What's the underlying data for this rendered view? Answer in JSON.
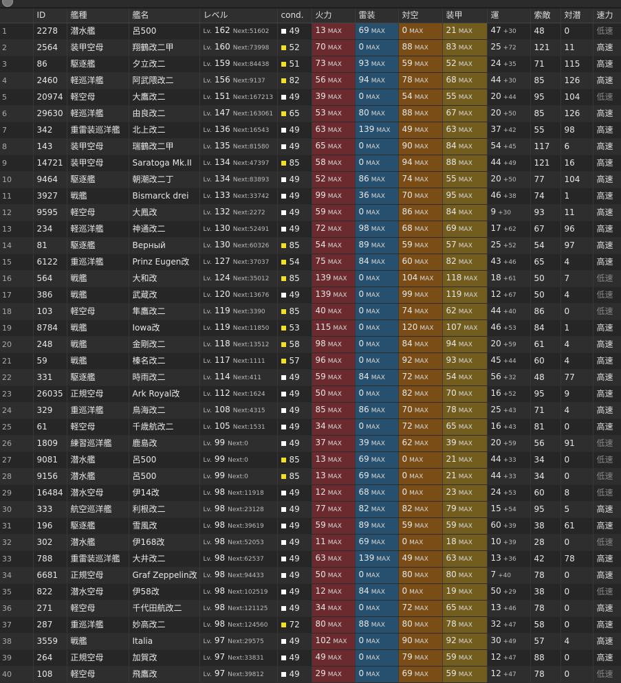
{
  "columns": [
    "ID",
    "艦種",
    "艦名",
    "レベル",
    "cond.",
    "火力",
    "雷装",
    "対空",
    "装甲",
    "運",
    "索敵",
    "対潜",
    "速力"
  ],
  "max_label": "MAX",
  "lv_prefix": "Lv.",
  "next_prefix": "Next:",
  "cond_colors": {
    "white": "#ffffff",
    "yellow": "#f2e11f"
  },
  "rows": [
    {
      "no": "1",
      "id": "2278",
      "type": "潜水艦",
      "name": "呂500",
      "lv": "162",
      "next": "51602",
      "cond": "49",
      "cc": "white",
      "fire": "13",
      "tor": "69",
      "aa": "0",
      "arm": "21",
      "luck": "47",
      "lp": "+30",
      "los": "48",
      "asw": "0",
      "spd": "低速"
    },
    {
      "no": "2",
      "id": "2564",
      "type": "装甲空母",
      "name": "翔鶴改二甲",
      "lv": "160",
      "next": "73998",
      "cond": "52",
      "cc": "yellow",
      "fire": "70",
      "tor": "0",
      "aa": "88",
      "arm": "83",
      "luck": "25",
      "lp": "+72",
      "los": "121",
      "asw": "11",
      "spd": "高速"
    },
    {
      "no": "3",
      "id": "86",
      "type": "駆逐艦",
      "name": "夕立改二",
      "lv": "159",
      "next": "84438",
      "cond": "51",
      "cc": "yellow",
      "fire": "73",
      "tor": "93",
      "aa": "59",
      "arm": "52",
      "luck": "24",
      "lp": "+35",
      "los": "71",
      "asw": "115",
      "spd": "高速"
    },
    {
      "no": "4",
      "id": "2460",
      "type": "軽巡洋艦",
      "name": "阿武隈改二",
      "lv": "156",
      "next": "9137",
      "cond": "82",
      "cc": "yellow",
      "fire": "56",
      "tor": "94",
      "aa": "78",
      "arm": "68",
      "luck": "44",
      "lp": "+30",
      "los": "85",
      "asw": "126",
      "spd": "高速"
    },
    {
      "no": "5",
      "id": "20974",
      "type": "軽空母",
      "name": "大鷹改二",
      "lv": "151",
      "next": "167213",
      "cond": "49",
      "cc": "white",
      "fire": "39",
      "tor": "0",
      "aa": "54",
      "arm": "55",
      "luck": "20",
      "lp": "+44",
      "los": "95",
      "asw": "104",
      "spd": "低速"
    },
    {
      "no": "6",
      "id": "29630",
      "type": "軽巡洋艦",
      "name": "由良改二",
      "lv": "147",
      "next": "163061",
      "cond": "65",
      "cc": "yellow",
      "fire": "53",
      "tor": "80",
      "aa": "88",
      "arm": "67",
      "luck": "20",
      "lp": "+50",
      "los": "85",
      "asw": "126",
      "spd": "高速"
    },
    {
      "no": "7",
      "id": "342",
      "type": "重雷装巡洋艦",
      "name": "北上改二",
      "lv": "136",
      "next": "16543",
      "cond": "49",
      "cc": "white",
      "fire": "63",
      "tor": "139",
      "aa": "49",
      "arm": "63",
      "luck": "37",
      "lp": "+42",
      "los": "55",
      "asw": "98",
      "spd": "高速"
    },
    {
      "no": "8",
      "id": "143",
      "type": "装甲空母",
      "name": "瑞鶴改二甲",
      "lv": "135",
      "next": "81580",
      "cond": "49",
      "cc": "white",
      "fire": "65",
      "tor": "0",
      "aa": "90",
      "arm": "84",
      "luck": "54",
      "lp": "+45",
      "los": "117",
      "asw": "6",
      "spd": "高速"
    },
    {
      "no": "9",
      "id": "14721",
      "type": "装甲空母",
      "name": "Saratoga Mk.II",
      "lv": "134",
      "next": "47397",
      "cond": "85",
      "cc": "yellow",
      "fire": "58",
      "tor": "0",
      "aa": "94",
      "arm": "88",
      "luck": "44",
      "lp": "+49",
      "los": "121",
      "asw": "16",
      "spd": "高速"
    },
    {
      "no": "10",
      "id": "9464",
      "type": "駆逐艦",
      "name": "朝潮改二丁",
      "lv": "134",
      "next": "83893",
      "cond": "49",
      "cc": "white",
      "fire": "52",
      "tor": "86",
      "aa": "74",
      "arm": "55",
      "luck": "20",
      "lp": "+50",
      "los": "77",
      "asw": "104",
      "spd": "高速"
    },
    {
      "no": "11",
      "id": "3927",
      "type": "戦艦",
      "name": "Bismarck drei",
      "lv": "133",
      "next": "33742",
      "cond": "49",
      "cc": "white",
      "fire": "99",
      "tor": "36",
      "aa": "70",
      "arm": "95",
      "luck": "46",
      "lp": "+38",
      "los": "74",
      "asw": "1",
      "spd": "高速"
    },
    {
      "no": "12",
      "id": "9595",
      "type": "軽空母",
      "name": "大鳳改",
      "lv": "132",
      "next": "2272",
      "cond": "49",
      "cc": "white",
      "fire": "59",
      "tor": "0",
      "aa": "86",
      "arm": "84",
      "luck": "9",
      "lp": "+30",
      "los": "93",
      "asw": "11",
      "spd": "高速"
    },
    {
      "no": "13",
      "id": "234",
      "type": "軽巡洋艦",
      "name": "神通改二",
      "lv": "130",
      "next": "52491",
      "cond": "49",
      "cc": "white",
      "fire": "72",
      "tor": "98",
      "aa": "68",
      "arm": "69",
      "luck": "17",
      "lp": "+62",
      "los": "67",
      "asw": "96",
      "spd": "高速"
    },
    {
      "no": "14",
      "id": "81",
      "type": "駆逐艦",
      "name": "Верный",
      "lv": "130",
      "next": "60326",
      "cond": "85",
      "cc": "yellow",
      "fire": "54",
      "tor": "89",
      "aa": "59",
      "arm": "57",
      "luck": "25",
      "lp": "+52",
      "los": "54",
      "asw": "97",
      "spd": "高速"
    },
    {
      "no": "15",
      "id": "6122",
      "type": "重巡洋艦",
      "name": "Prinz Eugen改",
      "lv": "127",
      "next": "37037",
      "cond": "54",
      "cc": "yellow",
      "fire": "75",
      "tor": "84",
      "aa": "60",
      "arm": "82",
      "luck": "43",
      "lp": "+46",
      "los": "65",
      "asw": "4",
      "spd": "高速"
    },
    {
      "no": "16",
      "id": "564",
      "type": "戦艦",
      "name": "大和改",
      "lv": "124",
      "next": "35012",
      "cond": "85",
      "cc": "yellow",
      "fire": "139",
      "tor": "0",
      "aa": "104",
      "arm": "118",
      "luck": "18",
      "lp": "+61",
      "los": "50",
      "asw": "7",
      "spd": "低速"
    },
    {
      "no": "17",
      "id": "386",
      "type": "戦艦",
      "name": "武蔵改",
      "lv": "120",
      "next": "13676",
      "cond": "49",
      "cc": "white",
      "fire": "139",
      "tor": "0",
      "aa": "99",
      "arm": "119",
      "luck": "12",
      "lp": "+67",
      "los": "50",
      "asw": "4",
      "spd": "低速"
    },
    {
      "no": "18",
      "id": "103",
      "type": "軽空母",
      "name": "隼鷹改二",
      "lv": "119",
      "next": "3390",
      "cond": "85",
      "cc": "yellow",
      "fire": "40",
      "tor": "0",
      "aa": "74",
      "arm": "62",
      "luck": "44",
      "lp": "+40",
      "los": "86",
      "asw": "0",
      "spd": "低速"
    },
    {
      "no": "19",
      "id": "8784",
      "type": "戦艦",
      "name": "Iowa改",
      "lv": "119",
      "next": "11850",
      "cond": "53",
      "cc": "yellow",
      "fire": "115",
      "tor": "0",
      "aa": "120",
      "arm": "107",
      "luck": "46",
      "lp": "+53",
      "los": "84",
      "asw": "1",
      "spd": "高速"
    },
    {
      "no": "20",
      "id": "248",
      "type": "戦艦",
      "name": "金剛改二",
      "lv": "118",
      "next": "13512",
      "cond": "58",
      "cc": "yellow",
      "fire": "98",
      "tor": "0",
      "aa": "84",
      "arm": "94",
      "luck": "20",
      "lp": "+59",
      "los": "61",
      "asw": "4",
      "spd": "高速"
    },
    {
      "no": "21",
      "id": "59",
      "type": "戦艦",
      "name": "榛名改二",
      "lv": "117",
      "next": "1111",
      "cond": "57",
      "cc": "yellow",
      "fire": "96",
      "tor": "0",
      "aa": "92",
      "arm": "93",
      "luck": "45",
      "lp": "+44",
      "los": "60",
      "asw": "4",
      "spd": "高速"
    },
    {
      "no": "22",
      "id": "331",
      "type": "駆逐艦",
      "name": "時雨改二",
      "lv": "114",
      "next": "411",
      "cond": "49",
      "cc": "white",
      "fire": "59",
      "tor": "84",
      "aa": "72",
      "arm": "54",
      "luck": "56",
      "lp": "+32",
      "los": "48",
      "asw": "77",
      "spd": "高速"
    },
    {
      "no": "23",
      "id": "26035",
      "type": "正規空母",
      "name": "Ark Royal改",
      "lv": "112",
      "next": "1624",
      "cond": "49",
      "cc": "white",
      "fire": "50",
      "tor": "0",
      "aa": "82",
      "arm": "70",
      "luck": "16",
      "lp": "+52",
      "los": "95",
      "asw": "9",
      "spd": "高速"
    },
    {
      "no": "24",
      "id": "329",
      "type": "重巡洋艦",
      "name": "鳥海改二",
      "lv": "108",
      "next": "4315",
      "cond": "49",
      "cc": "white",
      "fire": "85",
      "tor": "86",
      "aa": "70",
      "arm": "78",
      "luck": "25",
      "lp": "+43",
      "los": "71",
      "asw": "4",
      "spd": "高速"
    },
    {
      "no": "25",
      "id": "61",
      "type": "軽空母",
      "name": "千歳航改二",
      "lv": "105",
      "next": "1531",
      "cond": "49",
      "cc": "white",
      "fire": "34",
      "tor": "0",
      "aa": "72",
      "arm": "65",
      "luck": "16",
      "lp": "+43",
      "los": "81",
      "asw": "0",
      "spd": "高速"
    },
    {
      "no": "26",
      "id": "1809",
      "type": "練習巡洋艦",
      "name": "鹿島改",
      "lv": "99",
      "next": "0",
      "cond": "49",
      "cc": "white",
      "fire": "37",
      "tor": "39",
      "aa": "62",
      "arm": "39",
      "luck": "20",
      "lp": "+59",
      "los": "56",
      "asw": "91",
      "spd": "低速"
    },
    {
      "no": "27",
      "id": "9081",
      "type": "潜水艦",
      "name": "呂500",
      "lv": "99",
      "next": "0",
      "cond": "85",
      "cc": "yellow",
      "fire": "13",
      "tor": "69",
      "aa": "0",
      "arm": "21",
      "luck": "44",
      "lp": "+33",
      "los": "34",
      "asw": "0",
      "spd": "低速"
    },
    {
      "no": "28",
      "id": "9156",
      "type": "潜水艦",
      "name": "呂500",
      "lv": "99",
      "next": "0",
      "cond": "85",
      "cc": "yellow",
      "fire": "13",
      "tor": "69",
      "aa": "0",
      "arm": "21",
      "luck": "44",
      "lp": "+33",
      "los": "34",
      "asw": "0",
      "spd": "低速"
    },
    {
      "no": "29",
      "id": "16484",
      "type": "潜水空母",
      "name": "伊14改",
      "lv": "98",
      "next": "11918",
      "cond": "49",
      "cc": "white",
      "fire": "12",
      "tor": "68",
      "aa": "0",
      "arm": "23",
      "luck": "24",
      "lp": "+53",
      "los": "60",
      "asw": "8",
      "spd": "低速"
    },
    {
      "no": "30",
      "id": "333",
      "type": "航空巡洋艦",
      "name": "利根改二",
      "lv": "98",
      "next": "23128",
      "cond": "49",
      "cc": "white",
      "fire": "77",
      "tor": "82",
      "aa": "82",
      "arm": "79",
      "luck": "15",
      "lp": "+54",
      "los": "95",
      "asw": "5",
      "spd": "高速"
    },
    {
      "no": "31",
      "id": "196",
      "type": "駆逐艦",
      "name": "雪風改",
      "lv": "98",
      "next": "39619",
      "cond": "49",
      "cc": "white",
      "fire": "59",
      "tor": "89",
      "aa": "59",
      "arm": "59",
      "luck": "60",
      "lp": "+39",
      "los": "38",
      "asw": "61",
      "spd": "高速"
    },
    {
      "no": "32",
      "id": "302",
      "type": "潜水艦",
      "name": "伊168改",
      "lv": "98",
      "next": "52053",
      "cond": "49",
      "cc": "white",
      "fire": "11",
      "tor": "69",
      "aa": "0",
      "arm": "18",
      "luck": "10",
      "lp": "+39",
      "los": "28",
      "asw": "0",
      "spd": "低速"
    },
    {
      "no": "33",
      "id": "788",
      "type": "重雷装巡洋艦",
      "name": "大井改二",
      "lv": "98",
      "next": "62537",
      "cond": "49",
      "cc": "white",
      "fire": "63",
      "tor": "139",
      "aa": "49",
      "arm": "63",
      "luck": "13",
      "lp": "+36",
      "los": "42",
      "asw": "78",
      "spd": "高速"
    },
    {
      "no": "34",
      "id": "6681",
      "type": "正規空母",
      "name": "Graf Zeppelin改",
      "lv": "98",
      "next": "94433",
      "cond": "49",
      "cc": "white",
      "fire": "50",
      "tor": "0",
      "aa": "80",
      "arm": "80",
      "luck": "7",
      "lp": "+40",
      "los": "78",
      "asw": "0",
      "spd": "高速"
    },
    {
      "no": "35",
      "id": "822",
      "type": "潜水空母",
      "name": "伊58改",
      "lv": "98",
      "next": "102519",
      "cond": "49",
      "cc": "white",
      "fire": "12",
      "tor": "84",
      "aa": "0",
      "arm": "19",
      "luck": "50",
      "lp": "+29",
      "los": "38",
      "asw": "0",
      "spd": "低速"
    },
    {
      "no": "36",
      "id": "271",
      "type": "軽空母",
      "name": "千代田航改二",
      "lv": "98",
      "next": "121125",
      "cond": "49",
      "cc": "white",
      "fire": "34",
      "tor": "0",
      "aa": "72",
      "arm": "65",
      "luck": "13",
      "lp": "+46",
      "los": "78",
      "asw": "0",
      "spd": "高速"
    },
    {
      "no": "37",
      "id": "287",
      "type": "重巡洋艦",
      "name": "妙高改二",
      "lv": "98",
      "next": "124560",
      "cond": "72",
      "cc": "yellow",
      "fire": "80",
      "tor": "88",
      "aa": "80",
      "arm": "78",
      "luck": "32",
      "lp": "+47",
      "los": "58",
      "asw": "0",
      "spd": "高速"
    },
    {
      "no": "38",
      "id": "3559",
      "type": "戦艦",
      "name": "Italia",
      "lv": "97",
      "next": "29575",
      "cond": "49",
      "cc": "white",
      "fire": "102",
      "tor": "0",
      "aa": "90",
      "arm": "92",
      "luck": "30",
      "lp": "+49",
      "los": "57",
      "asw": "4",
      "spd": "高速"
    },
    {
      "no": "39",
      "id": "264",
      "type": "正規空母",
      "name": "加賀改",
      "lv": "97",
      "next": "33831",
      "cond": "49",
      "cc": "white",
      "fire": "49",
      "tor": "0",
      "aa": "79",
      "arm": "59",
      "luck": "12",
      "lp": "+47",
      "los": "88",
      "asw": "0",
      "spd": "高速"
    },
    {
      "no": "40",
      "id": "108",
      "type": "軽空母",
      "name": "飛鷹改",
      "lv": "97",
      "next": "39812",
      "cond": "49",
      "cc": "white",
      "fire": "29",
      "tor": "0",
      "aa": "69",
      "arm": "59",
      "luck": "12",
      "lp": "+47",
      "los": "78",
      "asw": "0",
      "spd": "低速"
    }
  ]
}
